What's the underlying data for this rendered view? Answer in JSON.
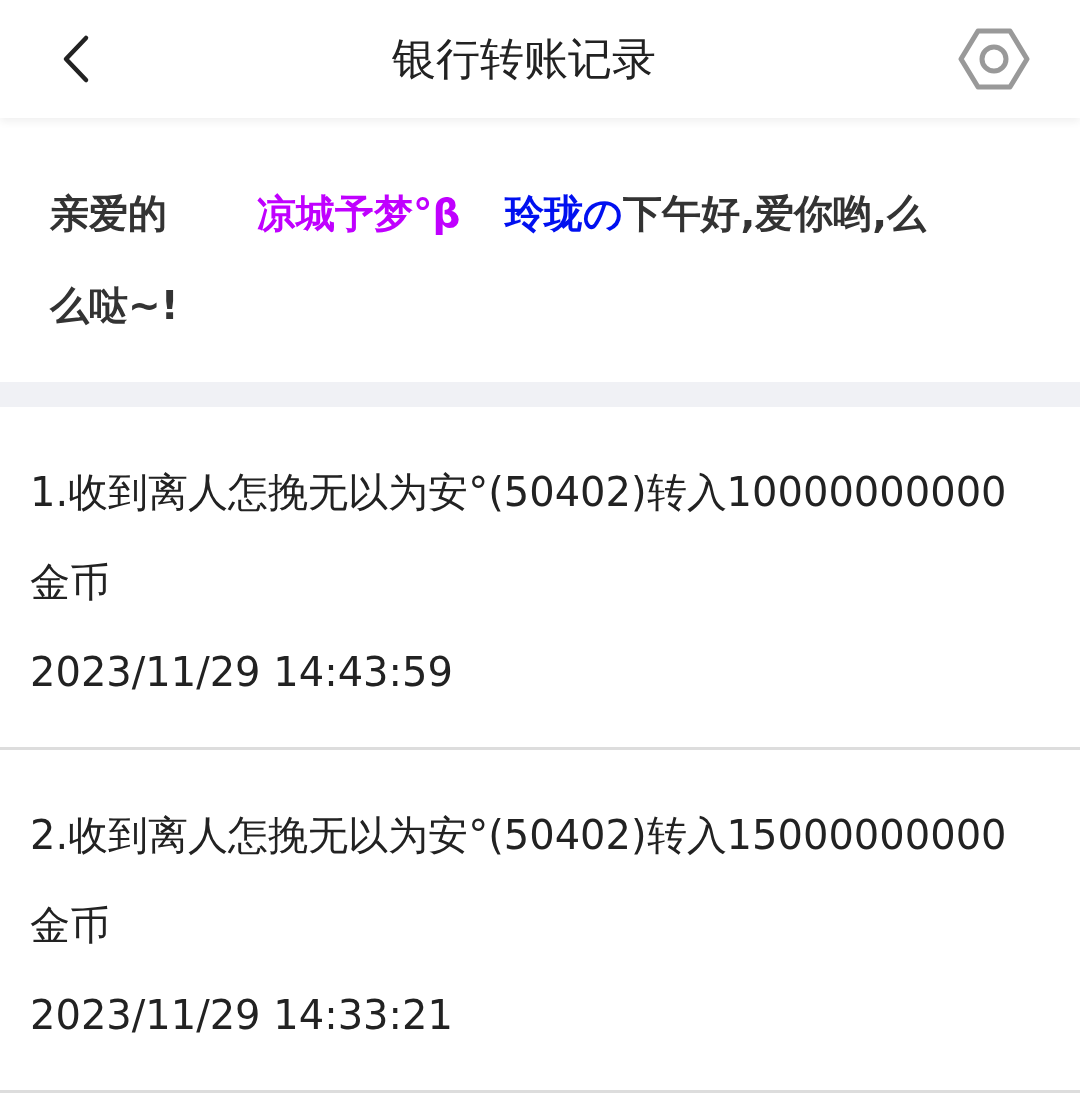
{
  "header": {
    "title": "银行转账记录"
  },
  "greeting": [
    {
      "kind": "plain",
      "text": "亲爱的"
    },
    {
      "kind": "gradient",
      "text": "凉城予梦°β",
      "color": "#c000ff"
    },
    {
      "kind": "gradient",
      "text": "玲珑の",
      "color": "#0010f0"
    },
    {
      "kind": "plain",
      "text": "下午好,爱你哟,么么哒~!"
    }
  ],
  "records": [
    {
      "text": "1.收到离人怎挽无以为安°(50402)转入10000000000金币",
      "time": "2023/11/29 14:43:59"
    },
    {
      "text": "2.收到离人怎挽无以为安°(50402)转入15000000000金币",
      "time": "2023/11/29 14:33:21"
    }
  ]
}
